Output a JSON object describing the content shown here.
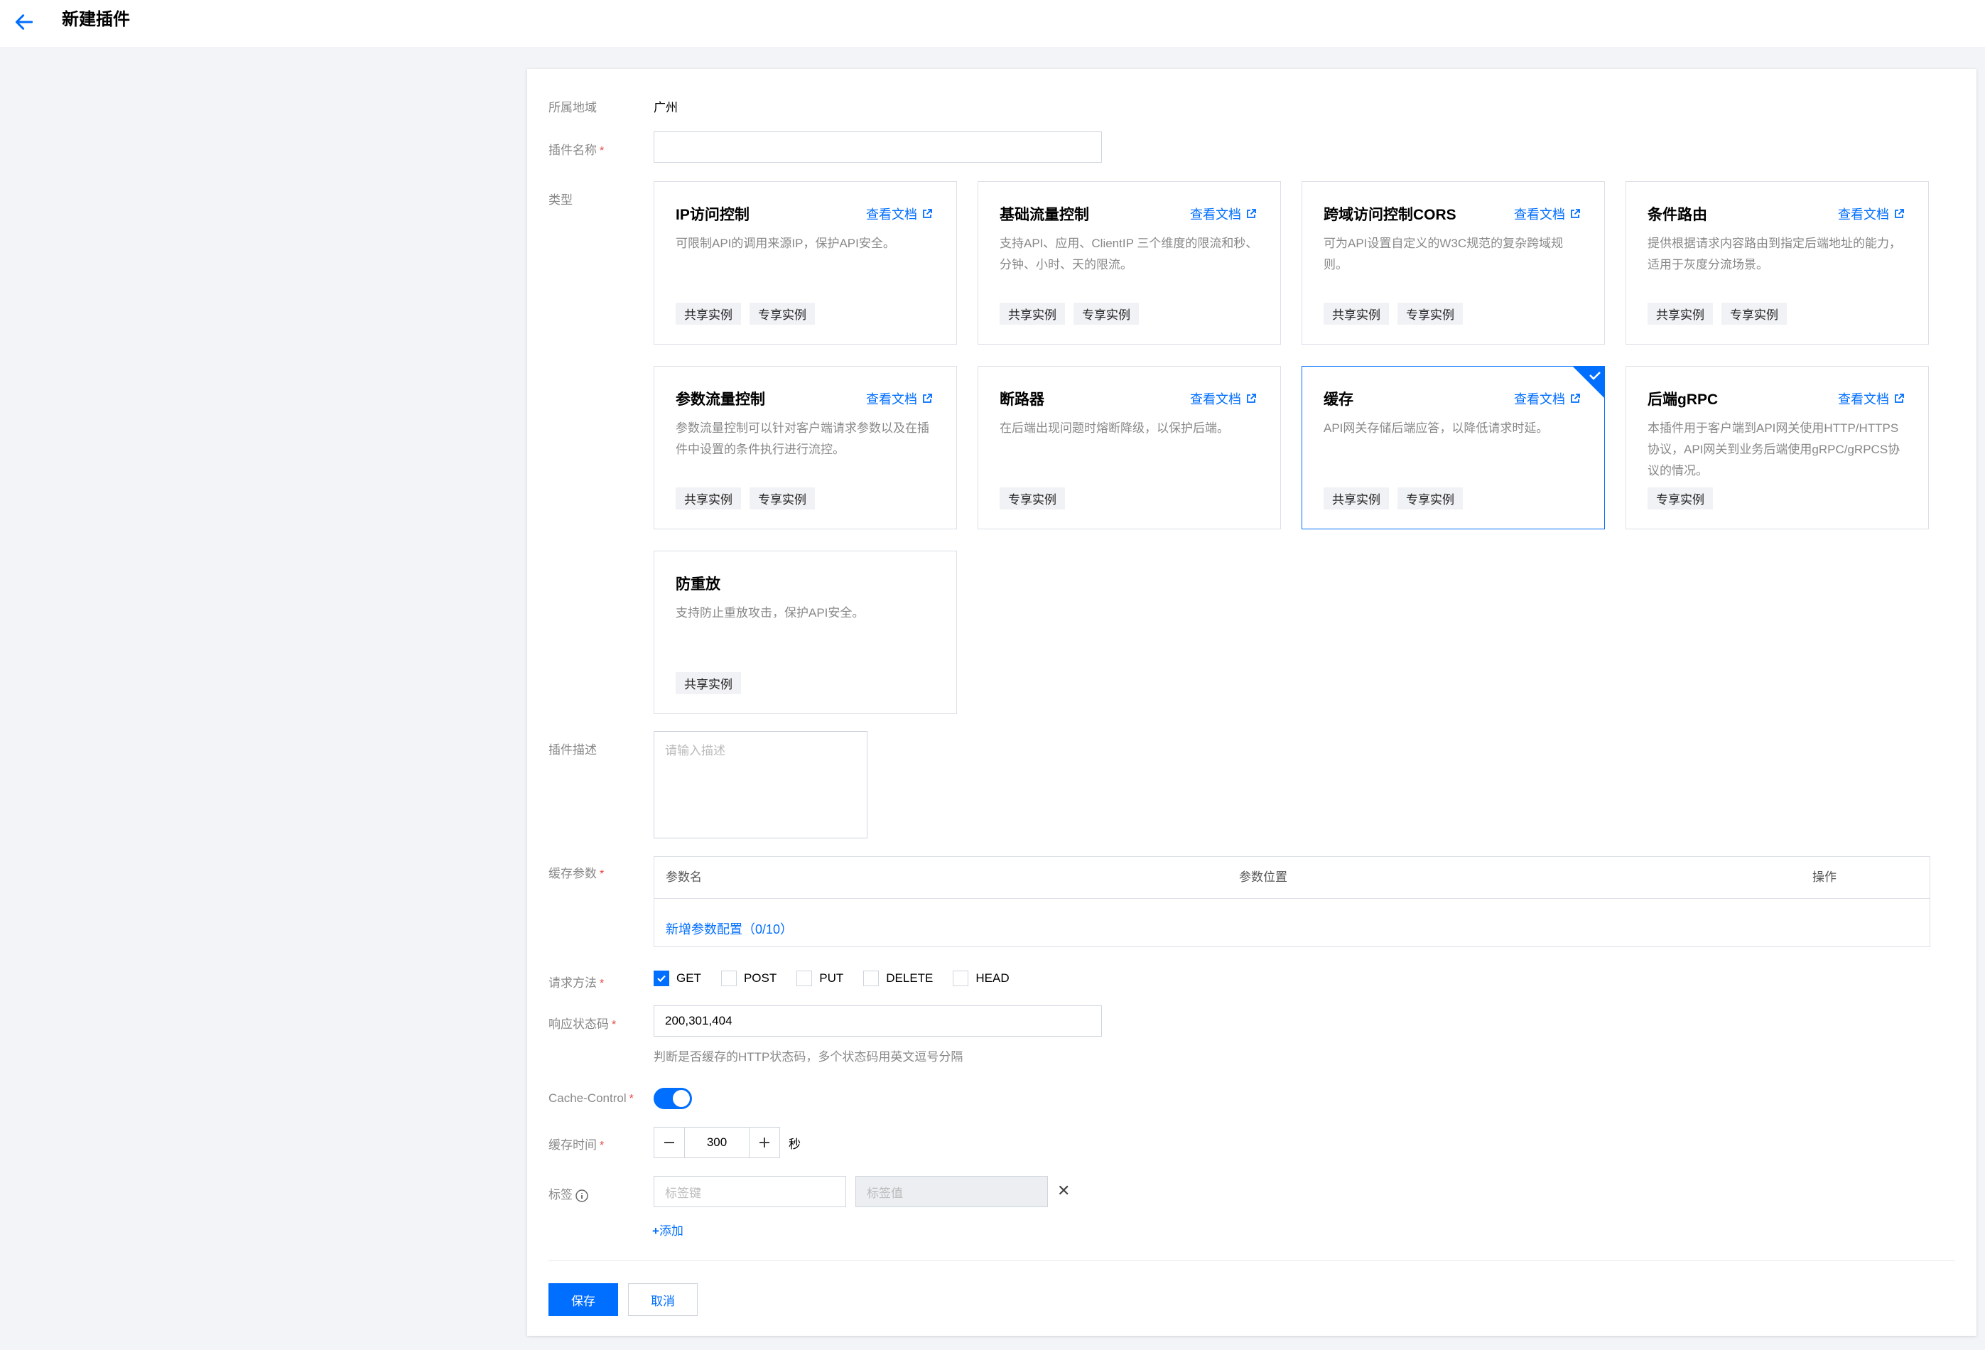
{
  "header": {
    "title": "新建插件",
    "back_icon": "arrow-left-icon"
  },
  "colors": {
    "primary": "#006eff",
    "required": "#e54545",
    "page_bg": "#f3f4f7"
  },
  "form": {
    "region": {
      "label": "所属地域",
      "value": "广州"
    },
    "plugin_name": {
      "label": "插件名称",
      "required_mark": "*",
      "value": ""
    },
    "type": {
      "label": "类型",
      "cards": [
        {
          "title": "IP访问控制",
          "doc_link": "查看文档",
          "desc": "可限制API的调用来源IP，保护API安全。",
          "tags": [
            "共享实例",
            "专享实例"
          ],
          "selected": false
        },
        {
          "title": "基础流量控制",
          "doc_link": "查看文档",
          "desc": "支持API、应用、ClientIP 三个维度的限流和秒、分钟、小时、天的限流。",
          "tags": [
            "共享实例",
            "专享实例"
          ],
          "selected": false
        },
        {
          "title": "跨域访问控制CORS",
          "doc_link": "查看文档",
          "desc": "可为API设置自定义的W3C规范的复杂跨域规则。",
          "tags": [
            "共享实例",
            "专享实例"
          ],
          "selected": false
        },
        {
          "title": "条件路由",
          "doc_link": "查看文档",
          "desc": "提供根据请求内容路由到指定后端地址的能力，适用于灰度分流场景。",
          "tags": [
            "共享实例",
            "专享实例"
          ],
          "selected": false
        },
        {
          "title": "参数流量控制",
          "doc_link": "查看文档",
          "desc": "参数流量控制可以针对客户端请求参数以及在插件中设置的条件执行进行流控。",
          "tags": [
            "共享实例",
            "专享实例"
          ],
          "selected": false
        },
        {
          "title": "断路器",
          "doc_link": "查看文档",
          "desc": "在后端出现问题时熔断降级，以保护后端。",
          "tags": [
            "专享实例"
          ],
          "selected": false
        },
        {
          "title": "缓存",
          "doc_link": "查看文档",
          "desc": "API网关存储后端应答，以降低请求时延。",
          "tags": [
            "共享实例",
            "专享实例"
          ],
          "selected": true
        },
        {
          "title": "后端gRPC",
          "doc_link": "查看文档",
          "desc": "本插件用于客户端到API网关使用HTTP/HTTPS协议，API网关到业务后端使用gRPC/gRPCS协议的情况。",
          "tags": [
            "专享实例"
          ],
          "selected": false
        },
        {
          "title": "防重放",
          "doc_link": null,
          "desc": "支持防止重放攻击，保护API安全。",
          "tags": [
            "共享实例"
          ],
          "selected": false
        }
      ]
    },
    "description": {
      "label": "插件描述",
      "placeholder": "请输入描述"
    },
    "cache_params": {
      "label": "缓存参数",
      "required_mark": "*",
      "columns": [
        "参数名",
        "参数位置",
        "操作"
      ],
      "add_link": "新增参数配置（0/10）"
    },
    "request_method": {
      "label": "请求方法",
      "required_mark": "*",
      "options": [
        {
          "label": "GET",
          "checked": true
        },
        {
          "label": "POST",
          "checked": false
        },
        {
          "label": "PUT",
          "checked": false
        },
        {
          "label": "DELETE",
          "checked": false
        },
        {
          "label": "HEAD",
          "checked": false
        }
      ]
    },
    "response_code": {
      "label": "响应状态码",
      "required_mark": "*",
      "value": "200,301,404",
      "hint": "判断是否缓存的HTTP状态码，多个状态码用英文逗号分隔"
    },
    "cache_control": {
      "label": "Cache-Control",
      "required_mark": "*",
      "enabled": true
    },
    "cache_time": {
      "label": "缓存时间",
      "required_mark": "*",
      "value": "300",
      "unit": "秒"
    },
    "tags": {
      "label": "标签",
      "key_placeholder": "标签键",
      "value_placeholder": "标签值",
      "add_label": "添加"
    }
  },
  "footer": {
    "save": "保存",
    "cancel": "取消"
  }
}
